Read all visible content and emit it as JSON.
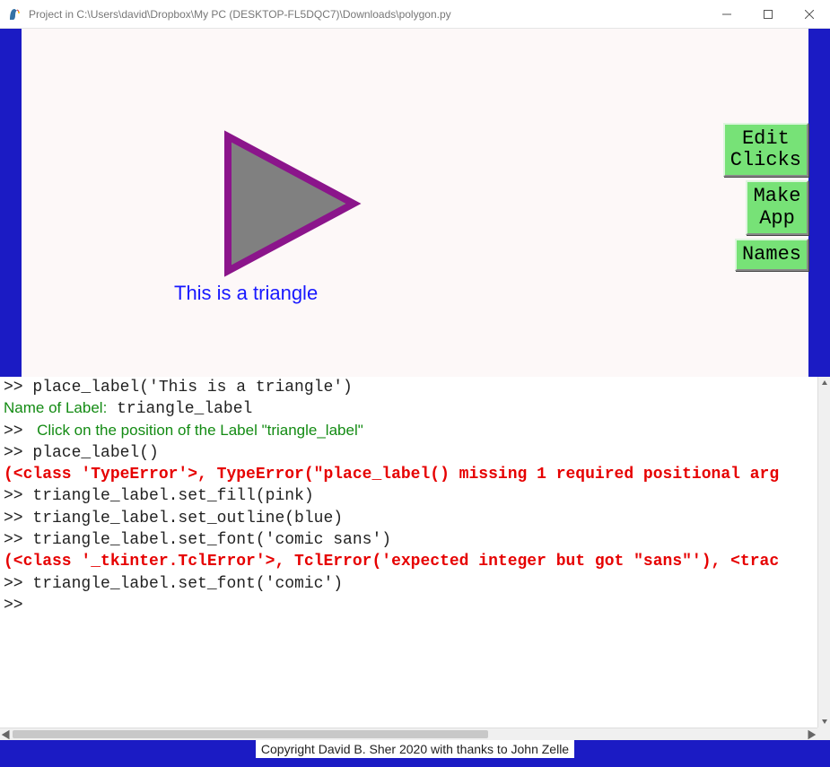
{
  "window": {
    "title": "Project in C:\\Users\\david\\Dropbox\\My PC (DESKTOP-FL5DQC7)\\Downloads\\polygon.py"
  },
  "canvas": {
    "triangle_label": "This is a triangle"
  },
  "buttons": {
    "edit_clicks_l1": "Edit",
    "edit_clicks_l2": "Clicks",
    "make_app_l1": "Make",
    "make_app_l2": "App",
    "names": "Names"
  },
  "console": {
    "l1": ">> place_label('This is a triangle')",
    "l2a": "Name of Label:",
    "l2b": " triangle_label",
    "l3a": ">> ",
    "l3b": " Click on the position of the Label \"triangle_label\"",
    "l4": ">> place_label()",
    "l5": "(<class 'TypeError'>, TypeError(\"place_label() missing 1 required positional arg",
    "l6": ">> triangle_label.set_fill(pink)",
    "l7": ">> triangle_label.set_outline(blue)",
    "l8": ">> triangle_label.set_font('comic sans')",
    "l9": "(<class '_tkinter.TclError'>, TclError('expected integer but got \"sans\"'), <trac",
    "l10": ">> triangle_label.set_font('comic')",
    "l11": ">>"
  },
  "footer": {
    "copyright": "Copyright David B. Sher 2020 with thanks to John Zelle"
  }
}
